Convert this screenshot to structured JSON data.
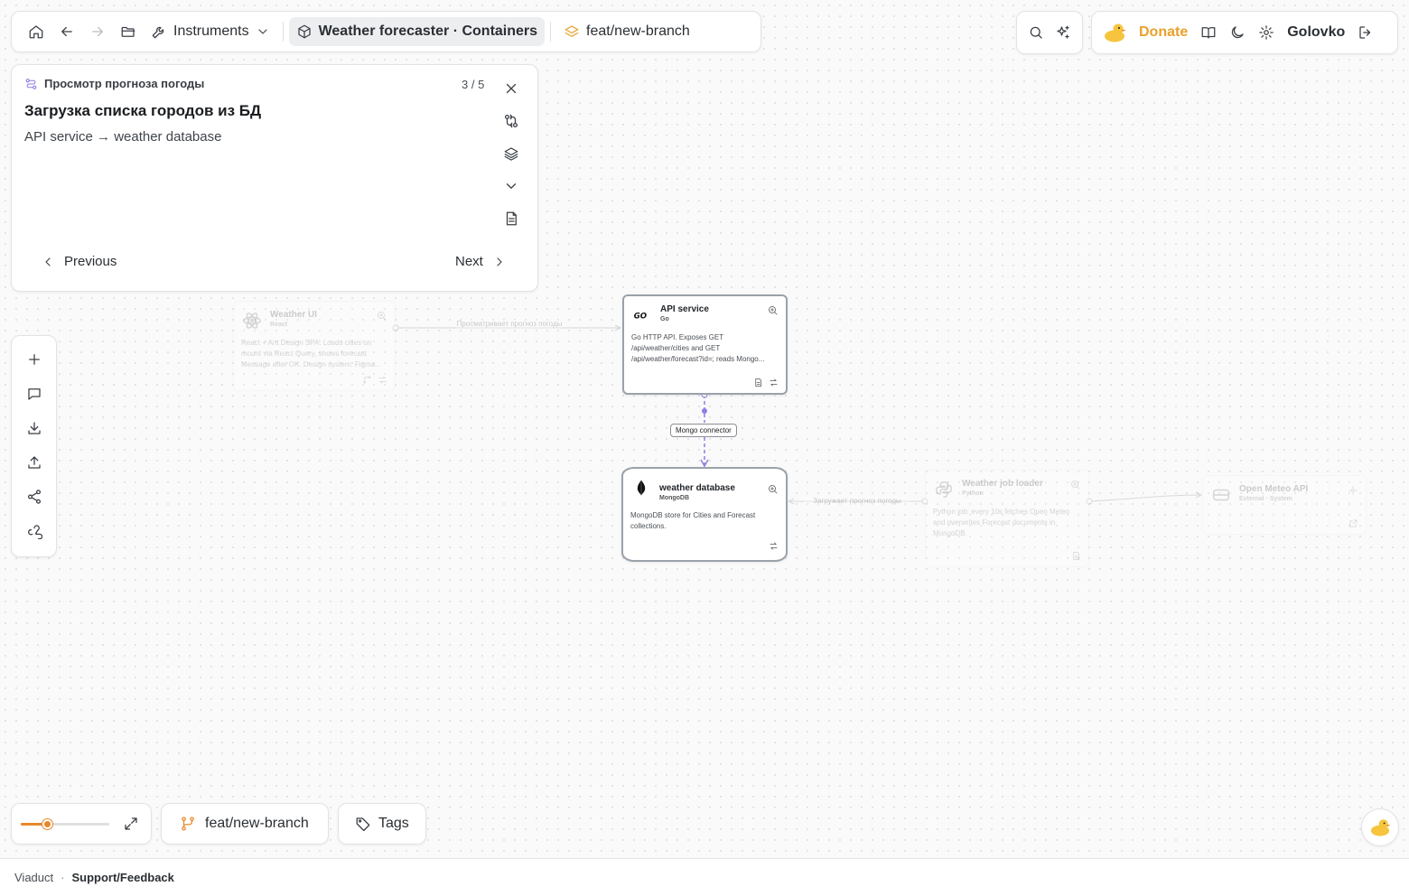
{
  "topnav": {
    "instruments_label": "Instruments",
    "project_label": "Weather forecaster · Containers",
    "branch_label": "feat/new-branch"
  },
  "userbar": {
    "donate_label": "Donate",
    "username": "Golovko"
  },
  "walkthrough": {
    "header": "Просмотр прогноза погоды",
    "counter": "3 / 5",
    "title": "Загрузка списка городов из БД",
    "subtitle": "API service → weather database",
    "previous_label": "Previous",
    "next_label": "Next"
  },
  "nodes": {
    "weather_ui": {
      "title": "Weather UI",
      "tech": "React",
      "desc": "React + Ant Design SPA. Loads cities on mount via React Query, shows forecast Message after OK. Design system: Figma..."
    },
    "api_service": {
      "title": "API service",
      "tech": "Go",
      "desc": "Go HTTP API. Exposes GET /api/weather/cities and GET /api/weather/forecast?id=; reads Mongo..."
    },
    "weather_db": {
      "title": "weather database",
      "tech": "MongoDB",
      "desc": "MongoDB store for Cities and Forecast collections."
    },
    "job_loader": {
      "title": "Weather job loader",
      "tech": "Python",
      "desc": "Python job: every 10s fetches Open Meteo and overwrites Forecast documents in MongoDB."
    },
    "open_meteo": {
      "title": "Open Meteo API",
      "tech": "External · System"
    }
  },
  "edges": {
    "ui_to_api": "Просматривает прогноз погоды",
    "api_to_db": "Mongo connector",
    "job_to_db": "Загружает прогноз погоды"
  },
  "bottombar": {
    "zoom_level": 0.3,
    "branch_label": "feat/new-branch",
    "tags_label": "Tags"
  },
  "footer": {
    "brand": "Viaduct",
    "separator": "·",
    "support_label": "Support/Feedback"
  },
  "colors": {
    "accent": "#e8a12c",
    "zoom_accent": "#e8872a",
    "edge_highlight": "#8c7ee6"
  }
}
